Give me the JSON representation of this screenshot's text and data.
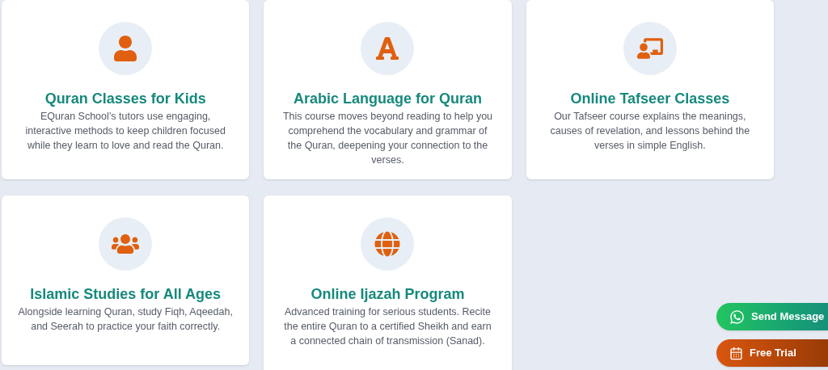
{
  "courses": [
    {
      "title": "Quran Classes for Kids",
      "description": "EQuran School’s tutors use engaging, interactive methods to keep children focused while they learn to love and read the Quran."
    },
    {
      "title": "Arabic Language for Quran",
      "description": "This course moves beyond reading to help you comprehend the vocabulary and grammar of the Quran, deepening your connection to the verses."
    },
    {
      "title": "Online Tafseer Classes",
      "description": "Our Tafseer course explains the meanings, causes of revelation, and lessons behind the verses in simple English."
    },
    {
      "title": "Islamic Studies for All Ages",
      "description": "Alongside learning Quran, study Fiqh, Aqeedah, and Seerah to practice your faith correctly."
    },
    {
      "title": "Online Ijazah Program",
      "description": "Advanced training for serious students. Recite the entire Quran to a certified Sheikh and earn a connected chain of transmission (Sanad)."
    }
  ],
  "floating_buttons": [
    {
      "label": "Send Message",
      "kind": "whatsapp"
    },
    {
      "label": "Free Trial",
      "kind": "trial"
    }
  ]
}
